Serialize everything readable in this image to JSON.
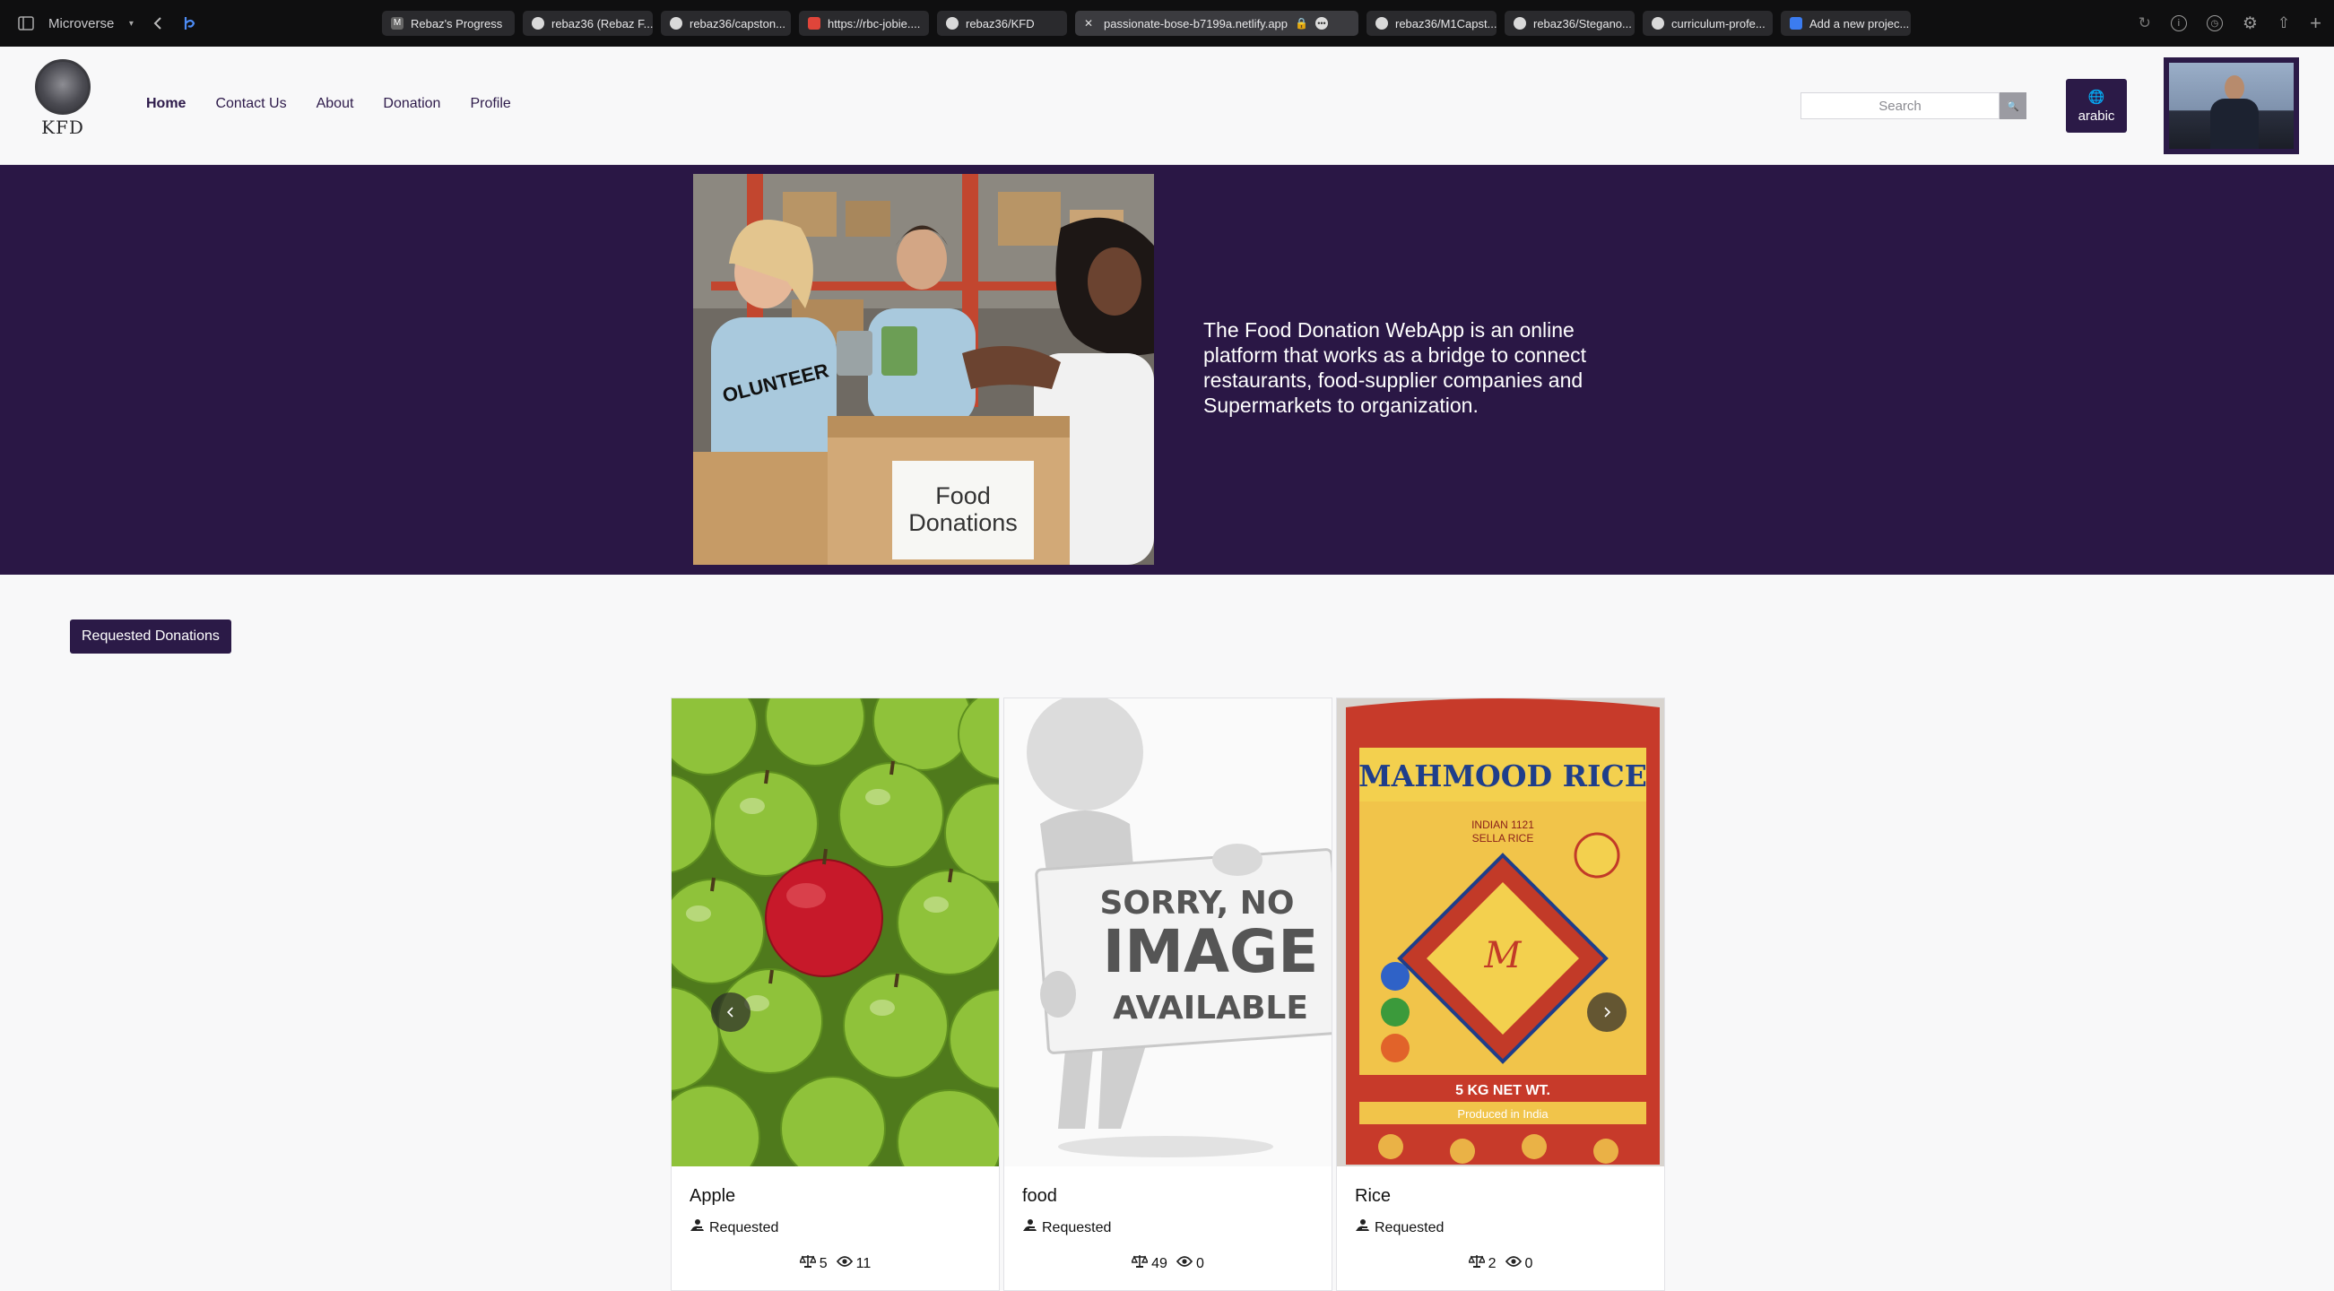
{
  "browser": {
    "profile_name": "Microverse",
    "tabs": [
      {
        "title": "Rebaz's Progress",
        "fav": "M"
      },
      {
        "title": "rebaz36 (Rebaz F...",
        "fav": "gh"
      },
      {
        "title": "rebaz36/capston...",
        "fav": "gh"
      },
      {
        "title": "https://rbc-jobie....",
        "fav": "red"
      },
      {
        "title": "rebaz36/KFD",
        "fav": "gh"
      },
      {
        "title": "passionate-bose-b7199a.netlify.app",
        "fav": "x",
        "active": true
      },
      {
        "title": "rebaz36/M1Capst...",
        "fav": "gh"
      },
      {
        "title": "rebaz36/Stegano...",
        "fav": "gh"
      },
      {
        "title": "curriculum-profe...",
        "fav": "gh"
      },
      {
        "title": "Add a new projec...",
        "fav": "docs"
      }
    ]
  },
  "header": {
    "logo_text": "KFD",
    "nav": [
      "Home",
      "Contact Us",
      "About",
      "Donation",
      "Profile"
    ],
    "search_placeholder": "Search",
    "lang_label": "arabic"
  },
  "hero": {
    "description": "The Food Donation WebApp is an online platform that works as a bridge to connect restaurants, food-supplier companies and Supermarkets to organization.",
    "image_caption_line1": "Food",
    "image_caption_line2": "Donations",
    "shirt_text": "OLUNTEER"
  },
  "requested": {
    "button_label": "Requested Donations",
    "cards": [
      {
        "title": "Apple",
        "status": "Requested",
        "quantity": "5",
        "views": "11"
      },
      {
        "title": "food",
        "status": "Requested",
        "quantity": "49",
        "views": "0"
      },
      {
        "title": "Rice",
        "status": "Requested",
        "quantity": "2",
        "views": "0"
      }
    ],
    "no_image": {
      "line1": "SORRY, NO",
      "line2": "IMAGE",
      "line3": "AVAILABLE"
    },
    "rice_bag": {
      "brand": "MAHMOOD RICE",
      "sub": "INDIAN 1121",
      "sub2": "SELLA RICE",
      "weight": "5 KG NET WT.",
      "origin": "Produced in India"
    }
  },
  "colors": {
    "brand_purple": "#2b1a47",
    "hero_bg": "#2a1745"
  }
}
